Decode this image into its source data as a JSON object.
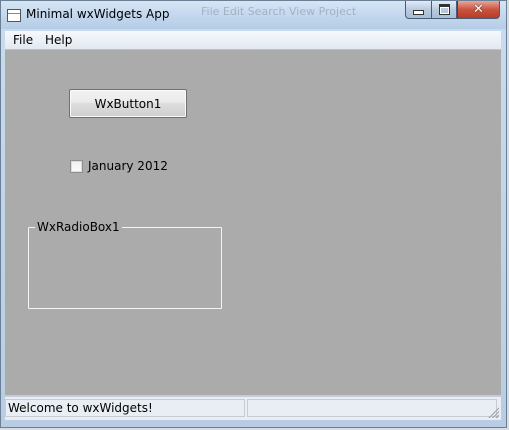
{
  "window": {
    "title": "Minimal wxWidgets App",
    "background_ghost": "File   Edit   Search   View   Project"
  },
  "titlebar_buttons": {
    "minimize_icon": "minimize-icon",
    "maximize_icon": "maximize-icon",
    "close_icon": "close-icon"
  },
  "menubar": {
    "items": [
      {
        "label": "File"
      },
      {
        "label": "Help"
      }
    ]
  },
  "client": {
    "button_label": "WxButton1",
    "checkbox": {
      "label": "January 2012",
      "checked": false
    },
    "radiobox": {
      "label": "WxRadioBox1"
    }
  },
  "statusbar": {
    "panes": [
      {
        "text": "Welcome to wxWidgets!"
      },
      {
        "text": ""
      }
    ]
  },
  "colors": {
    "client_background": "#ababab",
    "titlebar": "#c4d8ee",
    "close_button": "#c9543f"
  }
}
